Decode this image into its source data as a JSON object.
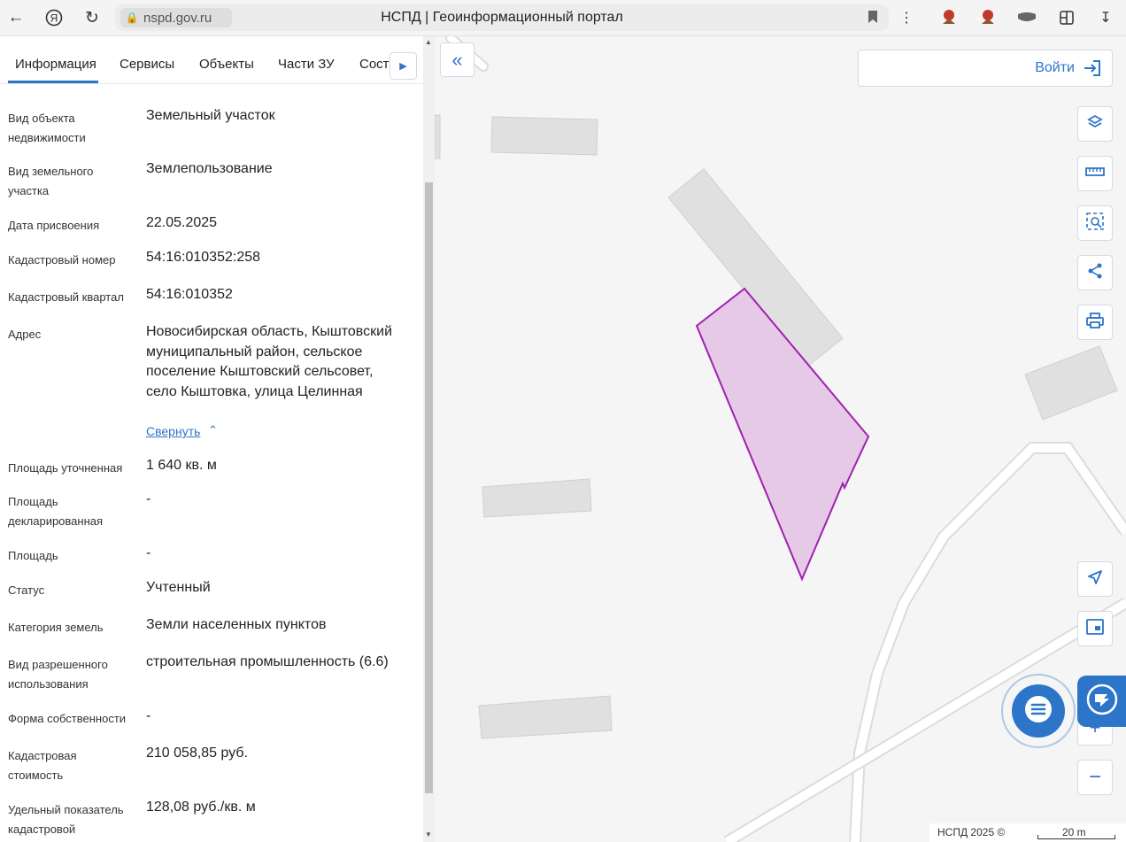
{
  "browser": {
    "url": "nspd.gov.ru",
    "title": "НСПД | Геоинформационный портал"
  },
  "tabs": [
    "Информация",
    "Сервисы",
    "Объекты",
    "Части ЗУ",
    "Соста"
  ],
  "info": {
    "rows": [
      {
        "label": "Вид объекта недвижимости",
        "value": "Земельный участок"
      },
      {
        "label": "Вид земельного участка",
        "value": "Землепользование"
      },
      {
        "label": "Дата присвоения",
        "value": "22.05.2025"
      },
      {
        "label": "Кадастровый номер",
        "value": "54:16:010352:258"
      },
      {
        "label": "Кадастровый квартал",
        "value": "54:16:010352"
      },
      {
        "label": "Адрес",
        "value": "Новосибирская область, Кыштовский муниципальный район, сельское поселение Кыштовский сельсовет, село Кыштовка, улица Целинная"
      },
      {
        "label": "Площадь уточненная",
        "value": "1 640 кв. м"
      },
      {
        "label": "Площадь декларированная",
        "value": "-"
      },
      {
        "label": "Площадь",
        "value": "-"
      },
      {
        "label": "Статус",
        "value": "Учтенный"
      },
      {
        "label": "Категория земель",
        "value": "Земли населенных пунктов"
      },
      {
        "label": "Вид разрешенного использования",
        "value": "строительная промышленность (6.6)"
      },
      {
        "label": "Форма собственности",
        "value": "-"
      },
      {
        "label": "Кадастровая стоимость",
        "value": "210 058,85 руб."
      },
      {
        "label": "Удельный показатель кадастровой",
        "value": "128,08 руб./кв. м"
      }
    ],
    "collapse_label": "Свернуть"
  },
  "map": {
    "login_label": "Войти",
    "copyright": "НСПД 2025 ©",
    "scale": "20 m",
    "parcel_fill": "#e5c9e6",
    "parcel_stroke": "#a020b0",
    "accent": "#2d75c9"
  }
}
